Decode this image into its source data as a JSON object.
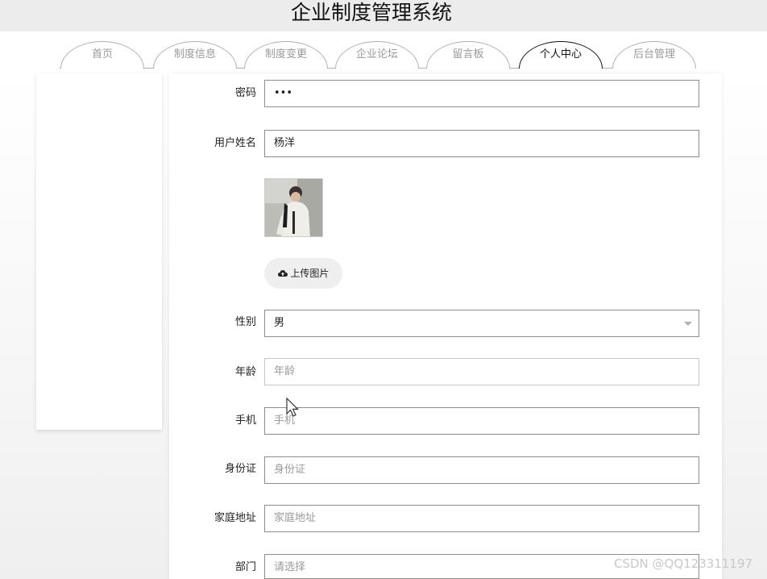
{
  "app": {
    "title": "企业制度管理系统"
  },
  "nav": {
    "tabs": [
      {
        "label": "首页",
        "active": false
      },
      {
        "label": "制度信息",
        "active": false
      },
      {
        "label": "制度变更",
        "active": false
      },
      {
        "label": "企业论坛",
        "active": false
      },
      {
        "label": "留言板",
        "active": false
      },
      {
        "label": "个人中心",
        "active": true
      },
      {
        "label": "后台管理",
        "active": false
      }
    ]
  },
  "form": {
    "password": {
      "label": "密码",
      "value": "•••"
    },
    "name": {
      "label": "用户姓名",
      "value": "杨洋"
    },
    "avatar": {
      "icon": "user-photo"
    },
    "upload": {
      "label": "上传图片",
      "icon": "cloud-upload-icon"
    },
    "gender": {
      "label": "性别",
      "value": "男"
    },
    "age": {
      "label": "年龄",
      "placeholder": "年龄"
    },
    "phone": {
      "label": "手机",
      "placeholder": "手机"
    },
    "id_card": {
      "label": "身份证",
      "placeholder": "身份证"
    },
    "address": {
      "label": "家庭地址",
      "placeholder": "家庭地址"
    },
    "department": {
      "label": "部门",
      "placeholder": "请选择"
    }
  },
  "watermark": "CSDN @QQ123311197"
}
